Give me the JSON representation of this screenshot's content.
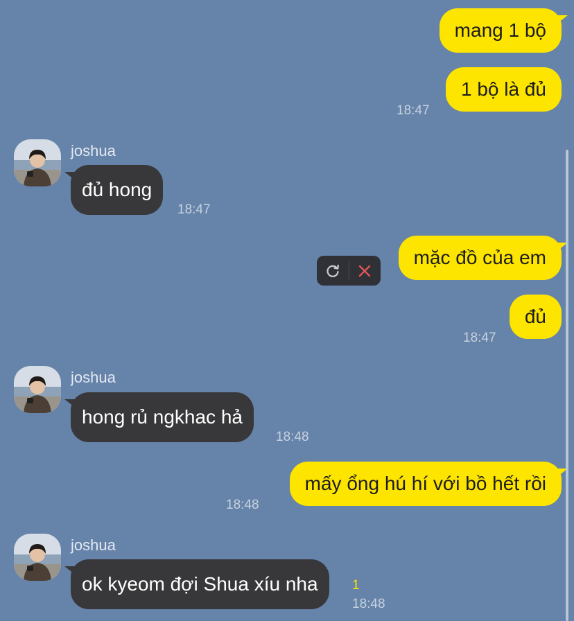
{
  "contact": {
    "name": "joshua"
  },
  "messages": [
    {
      "text": "mang 1 bộ"
    },
    {
      "text": "1 bộ là đủ",
      "time": "18:47"
    },
    {
      "text": "đủ hong",
      "time": "18:47"
    },
    {
      "text": "mặc đồ của em"
    },
    {
      "text": "đủ",
      "time": "18:47"
    },
    {
      "text": "hong rủ ngkhac hả",
      "time": "18:48"
    },
    {
      "text": "mấy ổng hú hí với bồ hết rồi",
      "time": "18:48"
    },
    {
      "text": "ok kyeom đợi Shua xíu nha",
      "time": "18:48",
      "unread": "1"
    }
  ],
  "colors": {
    "background": "#6683a9",
    "outgoing_bubble": "#fee500",
    "incoming_bubble": "#38383a",
    "unread_count": "#fee500",
    "delete_icon": "#e05555"
  },
  "icons": {
    "retry": "retry-icon",
    "delete": "delete-icon"
  }
}
